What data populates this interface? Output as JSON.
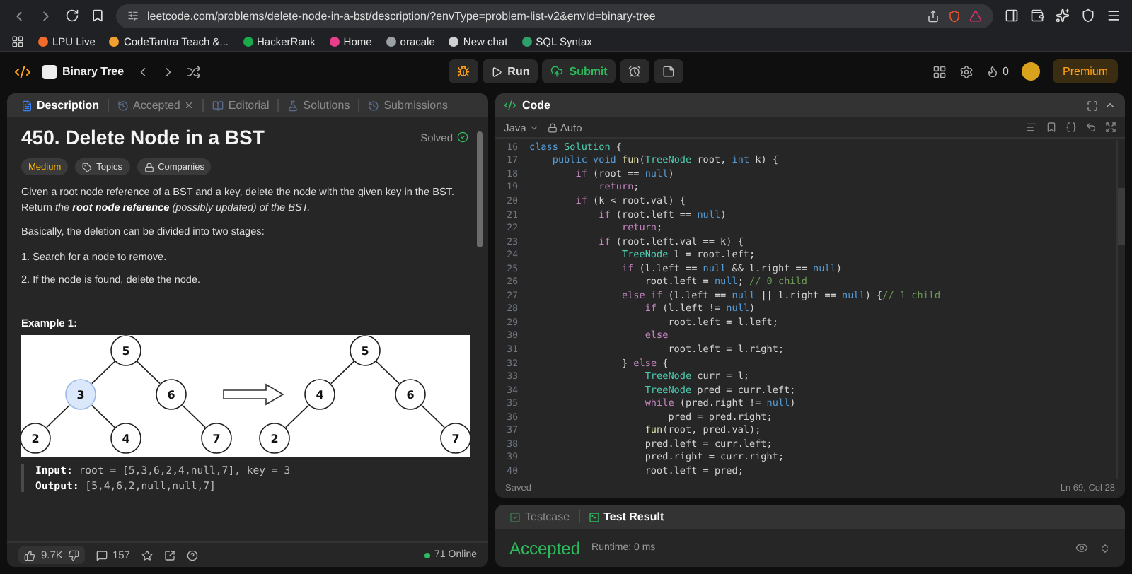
{
  "browser": {
    "url": "leetcode.com/problems/delete-node-in-a-bst/description/?envType=problem-list-v2&envId=binary-tree",
    "bookmarks": [
      {
        "label": "LPU Live",
        "color": "#f26b2a"
      },
      {
        "label": "CodeTantra Teach &...",
        "color": "#f0a030"
      },
      {
        "label": "HackerRank",
        "color": "#1ba94c"
      },
      {
        "label": "Home",
        "color": "#e83e8c"
      },
      {
        "label": "oracale",
        "color": "#9aa0a6"
      },
      {
        "label": "New chat",
        "color": "#d0d0d0"
      },
      {
        "label": "SQL Syntax",
        "color": "#2e9e6a"
      }
    ]
  },
  "header": {
    "problem_list": "Binary Tree",
    "run": "Run",
    "submit": "Submit",
    "streak": "0",
    "premium": "Premium"
  },
  "description": {
    "tabs": [
      {
        "label": "Description",
        "kind": "description",
        "selected": true,
        "closable": false
      },
      {
        "label": "Accepted",
        "kind": "accepted",
        "selected": false,
        "closable": true
      },
      {
        "label": "Editorial",
        "kind": "editorial",
        "selected": false,
        "closable": false
      },
      {
        "label": "Solutions",
        "kind": "solutions",
        "selected": false,
        "closable": false
      },
      {
        "label": "Submissions",
        "kind": "submissions",
        "selected": false,
        "closable": false
      }
    ],
    "title": "450. Delete Node in a BST",
    "status": "Solved",
    "tags": [
      {
        "label": "Medium",
        "kind": "difficulty"
      },
      {
        "label": "Topics",
        "kind": "topics"
      },
      {
        "label": "Companies",
        "kind": "companies"
      }
    ],
    "paragraphs": [
      "Given a root node reference of a BST and a key, delete the node with the given key in the BST. Return *the* **root node reference** *(possibly updated) of the BST.*",
      "Basically, the deletion can be divided into two stages:"
    ],
    "steps": [
      "1. Search for a node to remove.",
      "2. If the node is found, delete the node."
    ],
    "example_title": "Example 1:",
    "figure": {
      "trees": [
        {
          "root": {
            "label": "5",
            "highlighted": false,
            "left": {
              "label": "3",
              "highlighted": true,
              "left": {
                "label": "2",
                "highlighted": false
              },
              "right": {
                "label": "4",
                "highlighted": false
              }
            },
            "right": {
              "label": "6",
              "highlighted": false,
              "right": {
                "label": "7",
                "highlighted": false
              }
            }
          }
        },
        {
          "root": {
            "label": "5",
            "highlighted": false,
            "left": {
              "label": "4",
              "highlighted": false,
              "left": {
                "label": "2",
                "highlighted": false
              }
            },
            "right": {
              "label": "6",
              "highlighted": false,
              "right": {
                "label": "7",
                "highlighted": false
              }
            }
          }
        }
      ]
    },
    "example_lines": [
      {
        "label": "Input:",
        "value": "root = [5,3,6,2,4,null,7], key = 3"
      },
      {
        "label": "Output:",
        "value": "[5,4,6,2,null,null,7]"
      }
    ],
    "likes": "9.7K",
    "comments": "157",
    "online": "71 Online"
  },
  "editor": {
    "title": "Code",
    "language": "Java",
    "mode": "Auto",
    "saved": "Saved",
    "cursor": "Ln 69, Col 28",
    "lines": [
      {
        "number": "16",
        "tokens": [
          {
            "kind": "decl",
            "text": "class "
          },
          {
            "kind": "type",
            "text": "Solution"
          },
          {
            "kind": "p",
            "text": " {"
          }
        ]
      },
      {
        "number": "17",
        "tokens": [
          {
            "kind": "decl",
            "text": "    public void "
          },
          {
            "kind": "fn",
            "text": "fun"
          },
          {
            "kind": "p",
            "text": "("
          },
          {
            "kind": "type",
            "text": "TreeNode"
          },
          {
            "kind": "p",
            "text": " root, "
          },
          {
            "kind": "decl",
            "text": "int"
          },
          {
            "kind": "p",
            "text": " k) {"
          }
        ]
      },
      {
        "number": "18",
        "tokens": [
          {
            "kind": "kw",
            "text": "        if"
          },
          {
            "kind": "p",
            "text": " (root == "
          },
          {
            "kind": "decl",
            "text": "null"
          },
          {
            "kind": "p",
            "text": ")"
          }
        ]
      },
      {
        "number": "19",
        "tokens": [
          {
            "kind": "kw",
            "text": "            return"
          },
          {
            "kind": "p",
            "text": ";"
          }
        ]
      },
      {
        "number": "20",
        "tokens": [
          {
            "kind": "kw",
            "text": "        if"
          },
          {
            "kind": "p",
            "text": " (k < root.val) {"
          }
        ]
      },
      {
        "number": "21",
        "tokens": [
          {
            "kind": "kw",
            "text": "            if"
          },
          {
            "kind": "p",
            "text": " (root.left == "
          },
          {
            "kind": "decl",
            "text": "null"
          },
          {
            "kind": "p",
            "text": ")"
          }
        ]
      },
      {
        "number": "22",
        "tokens": [
          {
            "kind": "kw",
            "text": "                return"
          },
          {
            "kind": "p",
            "text": ";"
          }
        ]
      },
      {
        "number": "23",
        "tokens": [
          {
            "kind": "kw",
            "text": "            if"
          },
          {
            "kind": "p",
            "text": " (root.left.val == k) {"
          }
        ]
      },
      {
        "number": "24",
        "tokens": [
          {
            "kind": "type",
            "text": "                TreeNode"
          },
          {
            "kind": "p",
            "text": " l = root.left;"
          }
        ]
      },
      {
        "number": "25",
        "tokens": [
          {
            "kind": "kw",
            "text": "                if"
          },
          {
            "kind": "p",
            "text": " (l.left == "
          },
          {
            "kind": "decl",
            "text": "null"
          },
          {
            "kind": "p",
            "text": " && l.right == "
          },
          {
            "kind": "decl",
            "text": "null"
          },
          {
            "kind": "p",
            "text": ")"
          }
        ]
      },
      {
        "number": "26",
        "tokens": [
          {
            "kind": "p",
            "text": "                    root.left = "
          },
          {
            "kind": "decl",
            "text": "null"
          },
          {
            "kind": "p",
            "text": "; "
          },
          {
            "kind": "cm",
            "text": "// 0 child"
          }
        ]
      },
      {
        "number": "27",
        "tokens": [
          {
            "kind": "kw",
            "text": "                else if"
          },
          {
            "kind": "p",
            "text": " (l.left == "
          },
          {
            "kind": "decl",
            "text": "null"
          },
          {
            "kind": "p",
            "text": " || l.right == "
          },
          {
            "kind": "decl",
            "text": "null"
          },
          {
            "kind": "p",
            "text": ") {"
          },
          {
            "kind": "cm",
            "text": "// 1 child"
          }
        ]
      },
      {
        "number": "28",
        "tokens": [
          {
            "kind": "kw",
            "text": "                    if"
          },
          {
            "kind": "p",
            "text": " (l.left != "
          },
          {
            "kind": "decl",
            "text": "null"
          },
          {
            "kind": "p",
            "text": ")"
          }
        ]
      },
      {
        "number": "29",
        "tokens": [
          {
            "kind": "p",
            "text": "                        root.left = l.left;"
          }
        ]
      },
      {
        "number": "30",
        "tokens": [
          {
            "kind": "kw",
            "text": "                    else"
          }
        ]
      },
      {
        "number": "31",
        "tokens": [
          {
            "kind": "p",
            "text": "                        root.left = l.right;"
          }
        ]
      },
      {
        "number": "32",
        "tokens": [
          {
            "kind": "p",
            "text": "                } "
          },
          {
            "kind": "kw",
            "text": "else"
          },
          {
            "kind": "p",
            "text": " {"
          }
        ]
      },
      {
        "number": "33",
        "tokens": [
          {
            "kind": "type",
            "text": "                    TreeNode"
          },
          {
            "kind": "p",
            "text": " curr = l;"
          }
        ]
      },
      {
        "number": "34",
        "tokens": [
          {
            "kind": "type",
            "text": "                    TreeNode"
          },
          {
            "kind": "p",
            "text": " pred = curr.left;"
          }
        ]
      },
      {
        "number": "35",
        "tokens": [
          {
            "kind": "kw",
            "text": "                    while"
          },
          {
            "kind": "p",
            "text": " (pred.right != "
          },
          {
            "kind": "decl",
            "text": "null"
          },
          {
            "kind": "p",
            "text": ")"
          }
        ]
      },
      {
        "number": "36",
        "tokens": [
          {
            "kind": "p",
            "text": "                        pred = pred.right;"
          }
        ]
      },
      {
        "number": "37",
        "tokens": [
          {
            "kind": "fn",
            "text": "                    fun"
          },
          {
            "kind": "p",
            "text": "(root, pred.val);"
          }
        ]
      },
      {
        "number": "38",
        "tokens": [
          {
            "kind": "p",
            "text": "                    pred.left = curr.left;"
          }
        ]
      },
      {
        "number": "39",
        "tokens": [
          {
            "kind": "p",
            "text": "                    pred.right = curr.right;"
          }
        ]
      },
      {
        "number": "40",
        "tokens": [
          {
            "kind": "p",
            "text": "                    root.left = pred;"
          }
        ]
      }
    ]
  },
  "result": {
    "tabs": [
      {
        "label": "Testcase",
        "kind": "testcase",
        "selected": false
      },
      {
        "label": "Test Result",
        "kind": "result",
        "selected": true
      }
    ],
    "verdict": "Accepted",
    "runtime": "Runtime: 0 ms"
  }
}
